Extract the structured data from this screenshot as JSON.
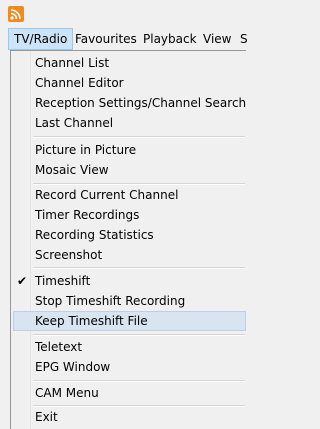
{
  "menubar": {
    "items": [
      "TV/Radio",
      "Favourites",
      "Playback",
      "View",
      "S"
    ]
  },
  "menu": {
    "items": [
      {
        "label": "Channel List"
      },
      {
        "label": "Channel Editor"
      },
      {
        "label": "Reception Settings/Channel Search"
      },
      {
        "label": "Last Channel"
      },
      {
        "label": "Picture in Picture"
      },
      {
        "label": "Mosaic View"
      },
      {
        "label": "Record Current Channel"
      },
      {
        "label": "Timer Recordings"
      },
      {
        "label": "Recording Statistics"
      },
      {
        "label": "Screenshot"
      },
      {
        "label": "Timeshift",
        "checked": true
      },
      {
        "label": "Stop Timeshift Recording"
      },
      {
        "label": "Keep Timeshift File",
        "highlighted": true
      },
      {
        "label": "Teletext"
      },
      {
        "label": "EPG Window"
      },
      {
        "label": "CAM Menu"
      },
      {
        "label": "Exit"
      }
    ],
    "check_mark": "✔"
  }
}
